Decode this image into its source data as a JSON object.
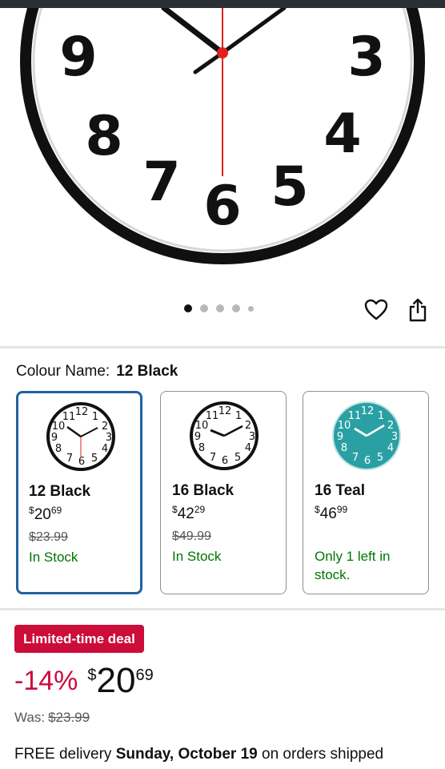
{
  "hero": {
    "clock_numerals": [
      "9",
      "3",
      "8",
      "4",
      "7",
      "6",
      "5"
    ]
  },
  "gallery": {
    "dot_count": 5,
    "active_index": 0
  },
  "actions": {
    "wishlist_icon": "heart-icon",
    "share_icon": "share-icon"
  },
  "colour": {
    "label": "Colour Name:",
    "selected": "12 Black"
  },
  "swatches": [
    {
      "name": "12 Black",
      "currency": "$",
      "price_whole": "20",
      "price_fraction": "69",
      "was": "$23.99",
      "stock": "In Stock",
      "face_color": "#ffffff",
      "selected": true
    },
    {
      "name": "16 Black",
      "currency": "$",
      "price_whole": "42",
      "price_fraction": "29",
      "was": "$49.99",
      "stock": "In Stock",
      "face_color": "#ffffff",
      "selected": false
    },
    {
      "name": "16 Teal",
      "currency": "$",
      "price_whole": "46",
      "price_fraction": "99",
      "was": "",
      "stock": "Only 1 left in stock.",
      "face_color": "#2aa0a4",
      "selected": false
    }
  ],
  "deal": {
    "badge": "Limited-time deal",
    "discount": "-14%",
    "currency": "$",
    "price_whole": "20",
    "price_fraction": "69",
    "was_label": "Was:",
    "was_value": "$23.99"
  },
  "delivery": {
    "prefix": "FREE delivery",
    "date": "Sunday, October 19",
    "suffix": "on orders shipped"
  },
  "colors": {
    "selected_border": "#2162a1",
    "deal_red": "#cc0c39",
    "in_stock_green": "#007600",
    "clock_hand_red": "#e02020"
  }
}
